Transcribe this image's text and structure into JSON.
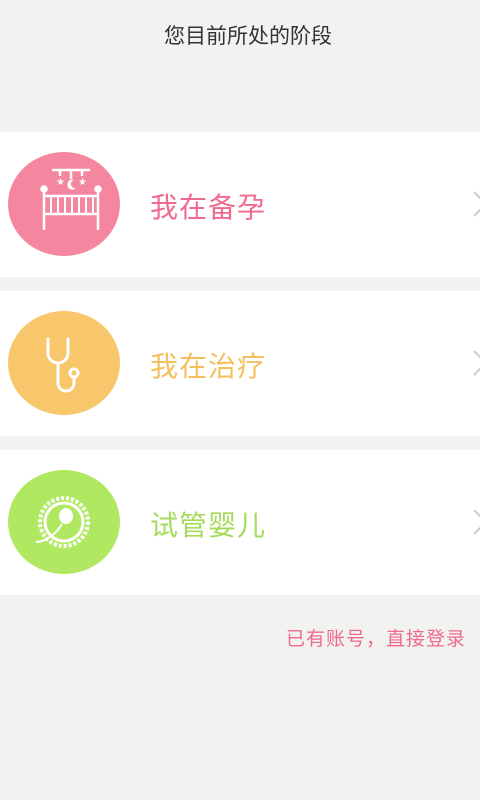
{
  "header": {
    "title": "您目前所处的阶段"
  },
  "stages": [
    {
      "label": "我在备孕",
      "icon": "crib-icon",
      "color": "#f5869f",
      "text_color": "#f06a8e"
    },
    {
      "label": "我在治疗",
      "icon": "stethoscope-icon",
      "color": "#f9c76b",
      "text_color": "#f5bf5e"
    },
    {
      "label": "试管婴儿",
      "icon": "sperm-egg-icon",
      "color": "#b0e862",
      "text_color": "#a4dc5a"
    }
  ],
  "footer": {
    "login_link": "已有账号，直接登录",
    "color": "#f06a8e"
  }
}
